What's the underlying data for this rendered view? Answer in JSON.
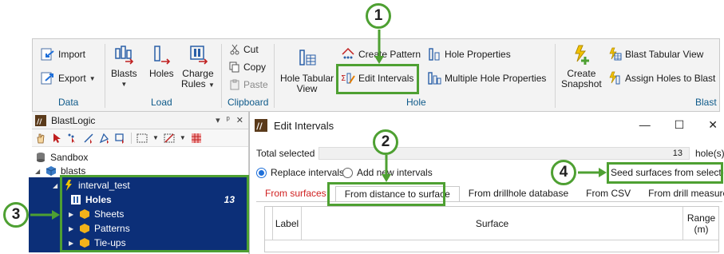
{
  "ribbon": {
    "data_group": {
      "label": "Data",
      "import": "Import",
      "export": "Export"
    },
    "load_group": {
      "label": "Load",
      "blasts": "Blasts",
      "holes": "Holes",
      "charge_rules_line1": "Charge",
      "charge_rules_line2": "Rules"
    },
    "clipboard_group": {
      "label": "Clipboard",
      "cut": "Cut",
      "copy": "Copy",
      "paste": "Paste"
    },
    "hole_group": {
      "label": "Hole",
      "hole_tabular_line1": "Hole Tabular",
      "hole_tabular_line2": "View",
      "create_pattern": "Create Pattern",
      "edit_intervals": "Edit Intervals",
      "hole_properties": "Hole Properties",
      "multiple_hole_properties": "Multiple Hole Properties"
    },
    "blast_group": {
      "label": "Blast",
      "create_snapshot_line1": "Create",
      "create_snapshot_line2": "Snapshot",
      "blast_tabular_view": "Blast Tabular View",
      "assign_holes": "Assign Holes to Blast"
    }
  },
  "panel": {
    "title": "BlastLogic",
    "tree": {
      "sandbox": "Sandbox",
      "blasts": "blasts",
      "interval_test": "interval_test",
      "holes": "Holes",
      "holes_count": "13",
      "sheets": "Sheets",
      "patterns": "Patterns",
      "tieups": "Tie-ups"
    }
  },
  "dialog": {
    "title": "Edit Intervals",
    "total_selected_label": "Total selected",
    "total_selected_value": "13",
    "total_selected_unit": "hole(s)",
    "replace_intervals": "Replace intervals",
    "add_new_intervals": "Add new intervals",
    "seed_surfaces": "Seed surfaces from selection",
    "tabs": [
      "From surfaces",
      "From distance to surface",
      "From drillhole database",
      "From CSV",
      "From drill measurements"
    ],
    "grid_headers": {
      "label": "Label",
      "surface": "Surface",
      "range_line1": "Range",
      "range_line2": "(m)"
    }
  },
  "callouts": [
    "1",
    "2",
    "3",
    "4"
  ],
  "colors": {
    "callout_green": "#4ea032",
    "selection_navy": "#0c2f78",
    "accent_blue": "#1e6fd9",
    "group_label": "#0e5a8a",
    "tab_red": "#d02020"
  }
}
